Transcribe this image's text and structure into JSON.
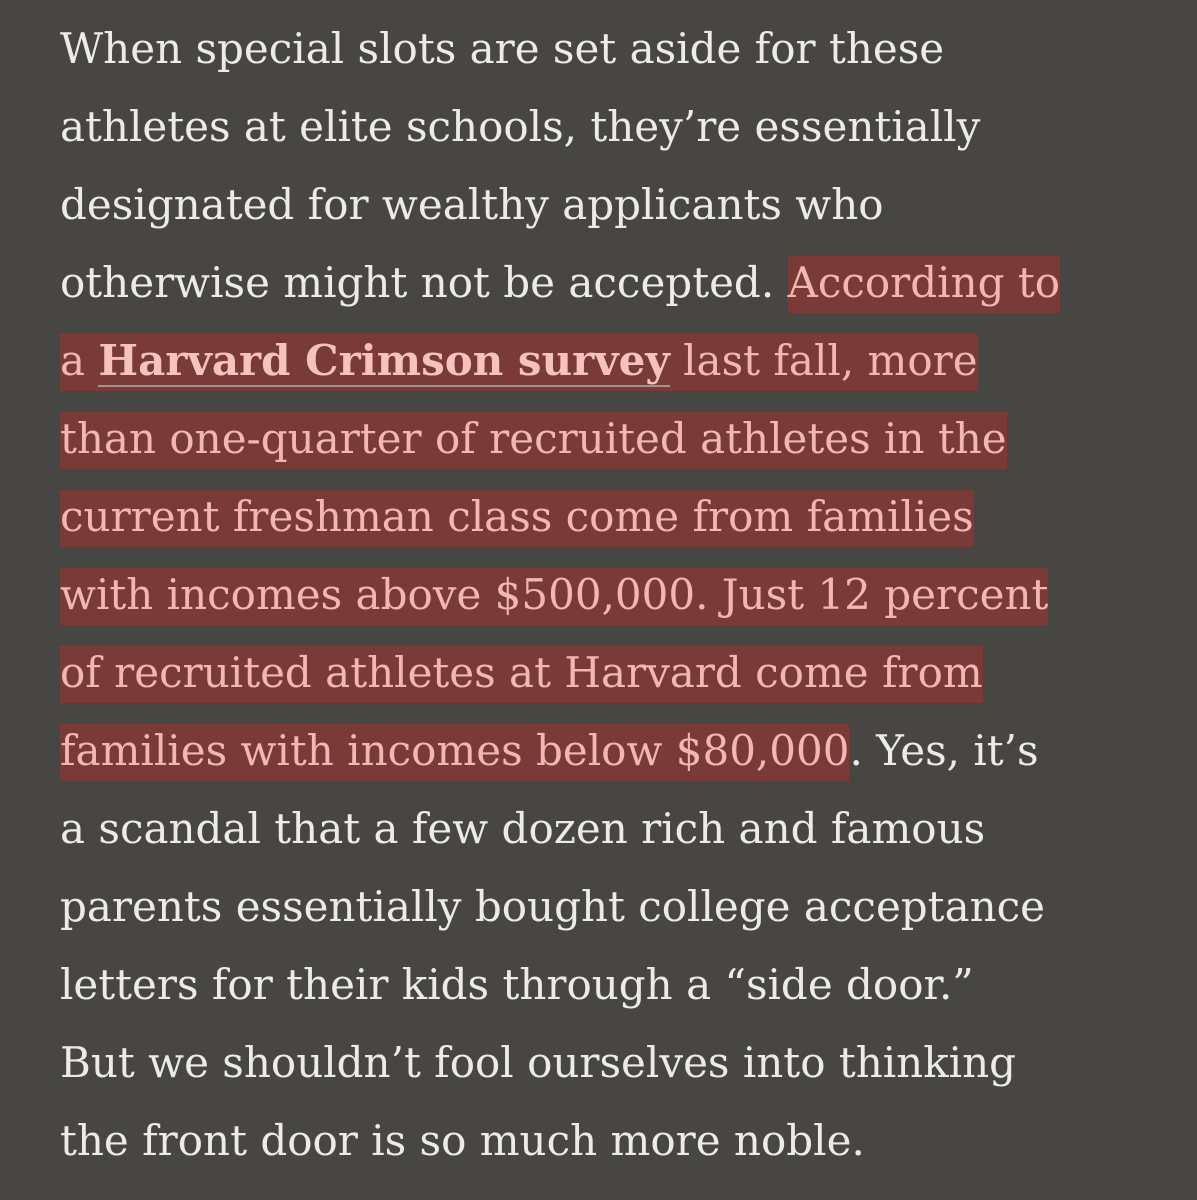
{
  "article": {
    "lines": [
      {
        "pre": "When special slots are set aside for these"
      },
      {
        "pre": "athletes at elite schools, they’re essentially"
      },
      {
        "pre": "designated for wealthy applicants who"
      },
      {
        "pre": "otherwise might not be accepted. ",
        "hl": "According to"
      },
      {
        "hl_pre": "a ",
        "link": "Harvard Crimson survey",
        "hl_post": " last fall, more"
      },
      {
        "hl": "than one-quarter of recruited athletes in the"
      },
      {
        "hl": "current freshman class come from families"
      },
      {
        "hl": "with incomes above $500,000. Just 12 percent"
      },
      {
        "hl": "of recruited athletes at Harvard come from"
      },
      {
        "hl": "families with incomes below $80,000",
        "post": ". Yes, it’s"
      },
      {
        "pre": "a scandal that a few dozen rich and famous"
      },
      {
        "pre": "parents essentially bought college acceptance"
      },
      {
        "pre": "letters for their kids through a “side door.”"
      },
      {
        "pre": "But we shouldn’t fool ourselves into thinking"
      },
      {
        "pre": "the front door is so much more noble."
      }
    ]
  },
  "colors": {
    "background": "#484643",
    "text": "#ecebe8",
    "highlight_bg": "#7a3a37",
    "highlight_text": "#f1b8b3"
  }
}
